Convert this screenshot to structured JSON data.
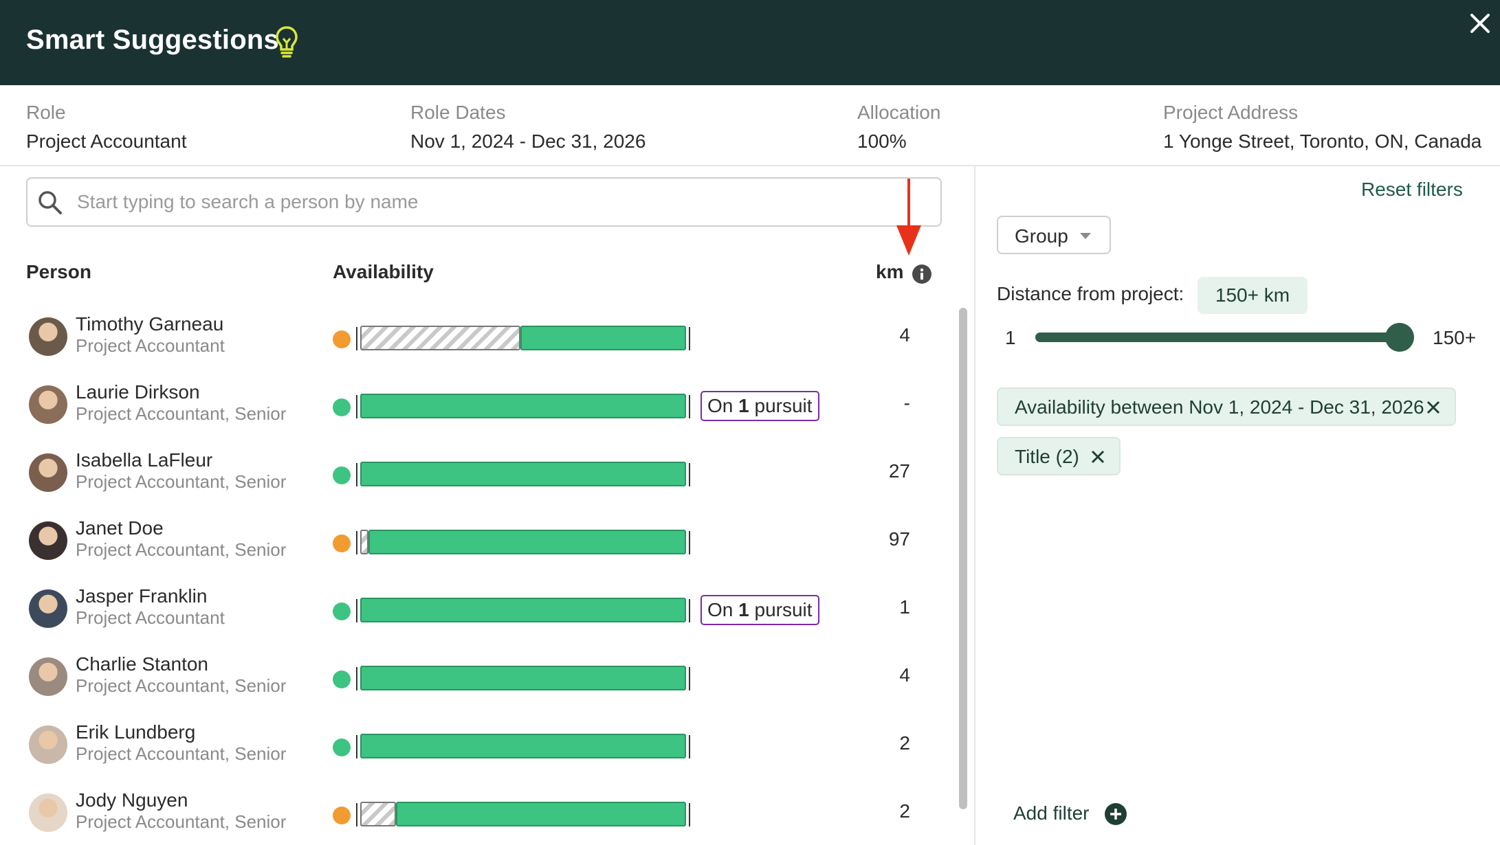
{
  "header": {
    "title": "Smart Suggestions"
  },
  "role_info": {
    "role": {
      "label": "Role",
      "value": "Project Accountant"
    },
    "dates": {
      "label": "Role Dates",
      "value": "Nov 1, 2024 - Dec 31, 2026"
    },
    "allocation": {
      "label": "Allocation",
      "value": "100%"
    },
    "address": {
      "label": "Project Address",
      "value": "1 Yonge Street, Toronto, ON, Canada"
    }
  },
  "search": {
    "placeholder": "Start typing to search a person by name",
    "value": ""
  },
  "table": {
    "columns": {
      "person": "Person",
      "availability": "Availability",
      "km": "km"
    },
    "rows": [
      {
        "name": "Timothy Garneau",
        "title": "Project Accountant",
        "status": "partial",
        "km": "4",
        "pursuit": null,
        "unavailable_fraction": 0.49
      },
      {
        "name": "Laurie Dirkson",
        "title": "Project Accountant, Senior",
        "status": "available",
        "km": "-",
        "pursuit": {
          "prefix": "On",
          "count": "1",
          "suffix": "pursuit"
        },
        "unavailable_fraction": 0
      },
      {
        "name": "Isabella LaFleur",
        "title": "Project Accountant, Senior",
        "status": "available",
        "km": "27",
        "pursuit": null,
        "unavailable_fraction": 0
      },
      {
        "name": "Janet Doe",
        "title": "Project Accountant, Senior",
        "status": "partial",
        "km": "97",
        "pursuit": null,
        "unavailable_fraction": 0.025
      },
      {
        "name": "Jasper Franklin",
        "title": "Project Accountant",
        "status": "available",
        "km": "1",
        "pursuit": {
          "prefix": "On",
          "count": "1",
          "suffix": "pursuit"
        },
        "unavailable_fraction": 0
      },
      {
        "name": "Charlie Stanton",
        "title": "Project Accountant, Senior",
        "status": "available",
        "km": "4",
        "pursuit": null,
        "unavailable_fraction": 0
      },
      {
        "name": "Erik Lundberg",
        "title": "Project Accountant, Senior",
        "status": "available",
        "km": "2",
        "pursuit": null,
        "unavailable_fraction": 0
      },
      {
        "name": "Jody Nguyen",
        "title": "Project Accountant, Senior",
        "status": "partial",
        "km": "2",
        "pursuit": null,
        "unavailable_fraction": 0.11
      }
    ]
  },
  "filters": {
    "reset_label": "Reset filters",
    "group_label": "Group",
    "distance": {
      "label": "Distance from project:",
      "chip": "150+ km",
      "min_label": "1",
      "max_label": "150+",
      "value_fraction": 1.0
    },
    "active": [
      {
        "label": "Availability between Nov 1, 2024 - Dec 31, 2026"
      },
      {
        "label": "Title (2)"
      }
    ],
    "add_label": "Add filter"
  },
  "colors": {
    "header_bg": "#1b3232",
    "available": "#3dc482",
    "partial": "#f29b30",
    "pursuit_border": "#7b2aa8",
    "accent_dark_green": "#2f5e4b",
    "annotation_arrow": "#e8311a"
  },
  "icons": {
    "bulb": "lightbulb-icon",
    "close": "close-icon",
    "search": "search-icon",
    "info": "info-icon",
    "chevron": "chevron-down-icon",
    "remove": "close-icon",
    "add": "plus-circle-icon"
  }
}
